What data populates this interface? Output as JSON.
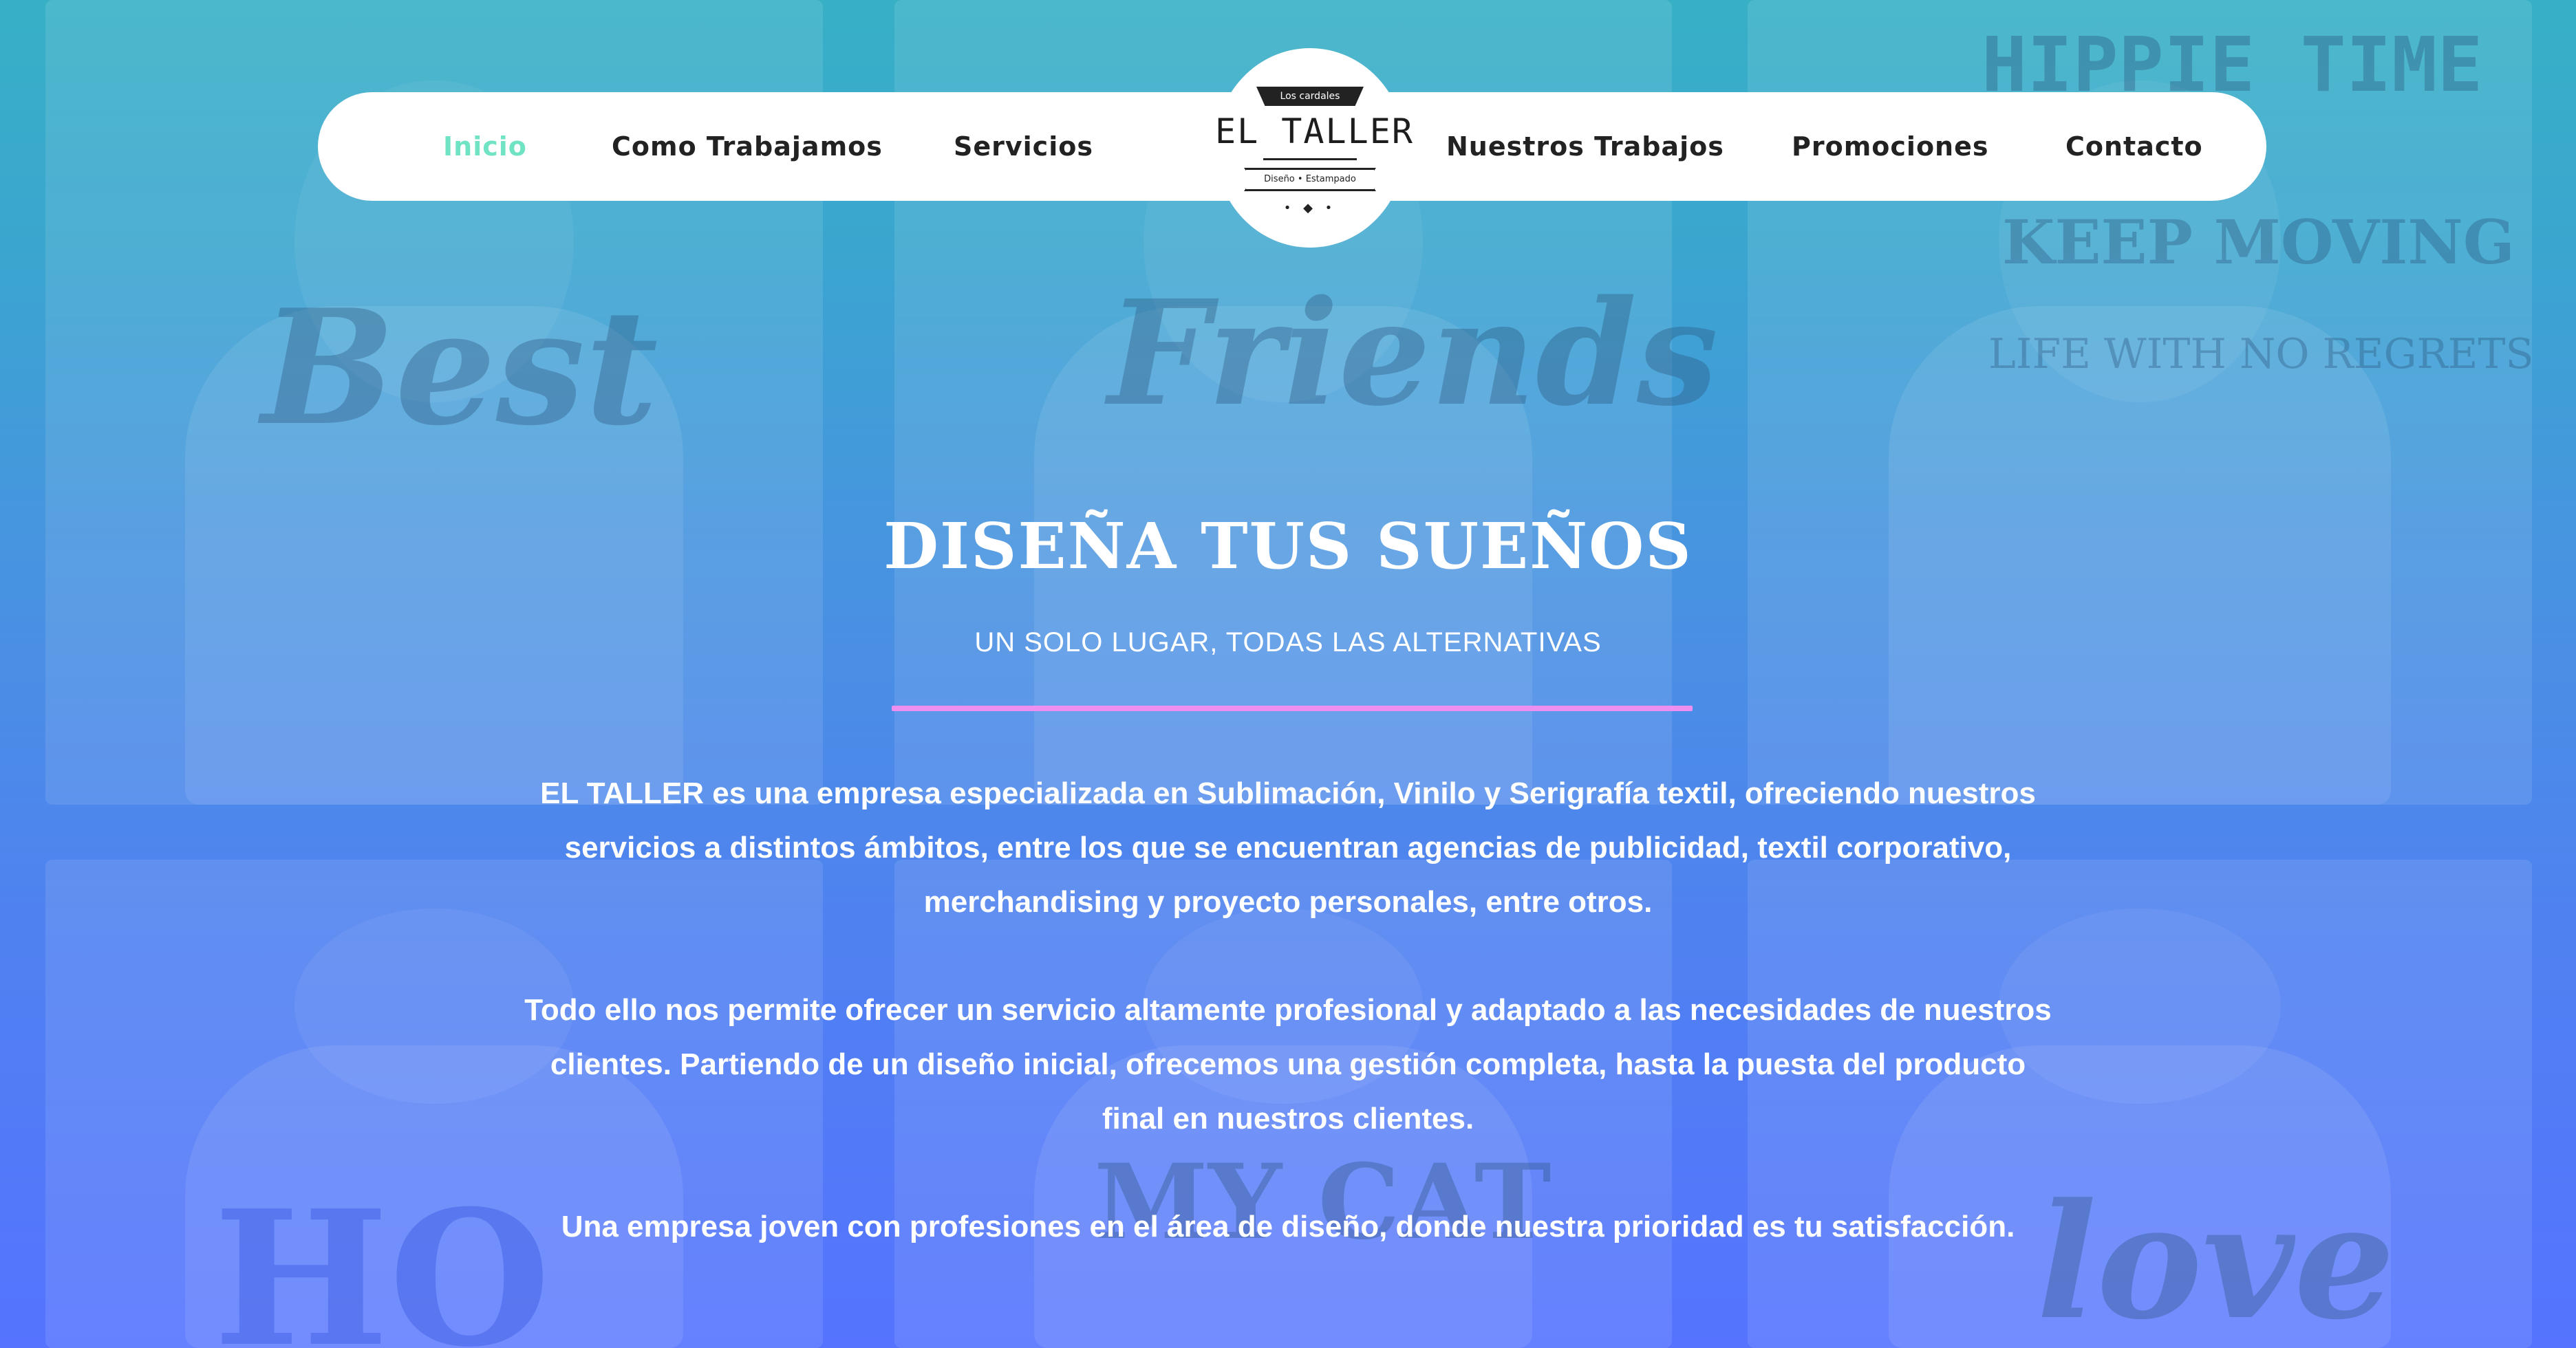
{
  "colors": {
    "gradient_top": "#37b0c6",
    "gradient_bottom": "#5573ff",
    "nav_active": "#6fe3c4",
    "nav_text": "#222222",
    "divider": "#ec8ff0",
    "hero_text": "#ffffff"
  },
  "nav": {
    "left_items": [
      {
        "label": "Inicio",
        "active": true
      },
      {
        "label": "Como Trabajamos",
        "active": false
      },
      {
        "label": "Servicios",
        "active": false
      }
    ],
    "right_items": [
      {
        "label": "Nuestros Trabajos",
        "active": false
      },
      {
        "label": "Promociones",
        "active": false
      },
      {
        "label": "Contacto",
        "active": false
      }
    ]
  },
  "logo": {
    "ribbon_top": "Los cardales",
    "title": "EL TALLER",
    "ribbon_bottom": "Diseño • Estampado"
  },
  "background_photos": {
    "words": [
      "Best",
      "Friends",
      "HIPPIE TIME",
      "KEEP MOVING",
      "LIFE WITH NO REGRETS",
      "HO",
      "MY CAT",
      "love"
    ]
  },
  "hero": {
    "title": "DISEÑA TUS SUEÑOS",
    "subtitle": "UN SOLO LUGAR, TODAS LAS ALTERNATIVAS",
    "paragraphs": [
      {
        "lines": [
          "EL TALLER es una empresa especializada en Sublimación, Vinilo y Serigrafía textil, ofreciendo nuestros",
          "servicios a distintos ámbitos, entre los que se encuentran agencias de publicidad, textil corporativo,",
          "merchandising y proyecto personales, entre otros."
        ]
      },
      {
        "lines": [
          "Todo ello nos permite ofrecer un servicio altamente profesional y adaptado a las necesidades de nuestros",
          "clientes. Partiendo de un diseño inicial, ofrecemos una gestión completa, hasta la puesta del producto",
          "final en nuestros clientes."
        ]
      },
      {
        "lines": [
          "Una empresa joven con profesiones en el área de diseño, donde nuestra prioridad es tu satisfacción."
        ]
      }
    ]
  }
}
